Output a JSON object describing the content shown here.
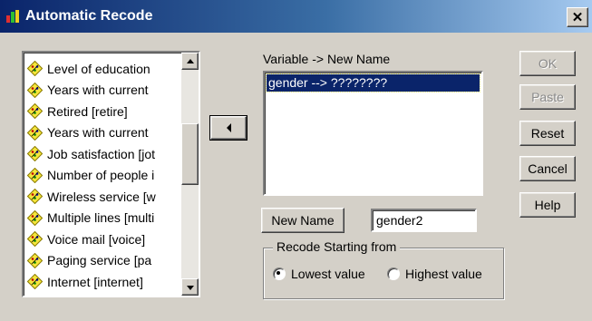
{
  "window": {
    "title": "Automatic Recode",
    "close_glyph": "✕"
  },
  "variables": [
    "Level of education",
    "Years with current",
    "Retired [retire]",
    "Years with current",
    "Job satisfaction [jot",
    "Number of people i",
    "Wireless service [w",
    "Multiple lines [multi",
    "Voice mail [voice]",
    "Paging service [pa",
    "Internet [internet]"
  ],
  "mapping": {
    "header": "Variable -> New Name",
    "items": [
      "gender --> ????????"
    ]
  },
  "new_name": {
    "button_label": "New Name",
    "value": "gender2"
  },
  "recode": {
    "legend": "Recode Starting from",
    "options": [
      "Lowest value",
      "Highest value"
    ],
    "selected": "Lowest value"
  },
  "buttons": {
    "ok": "OK",
    "paste": "Paste",
    "reset": "Reset",
    "cancel": "Cancel",
    "help": "Help"
  },
  "icons": {
    "app": "spss-app-icon",
    "variable": "nominal-variable-icon",
    "move": "move-left-arrow-icon"
  }
}
